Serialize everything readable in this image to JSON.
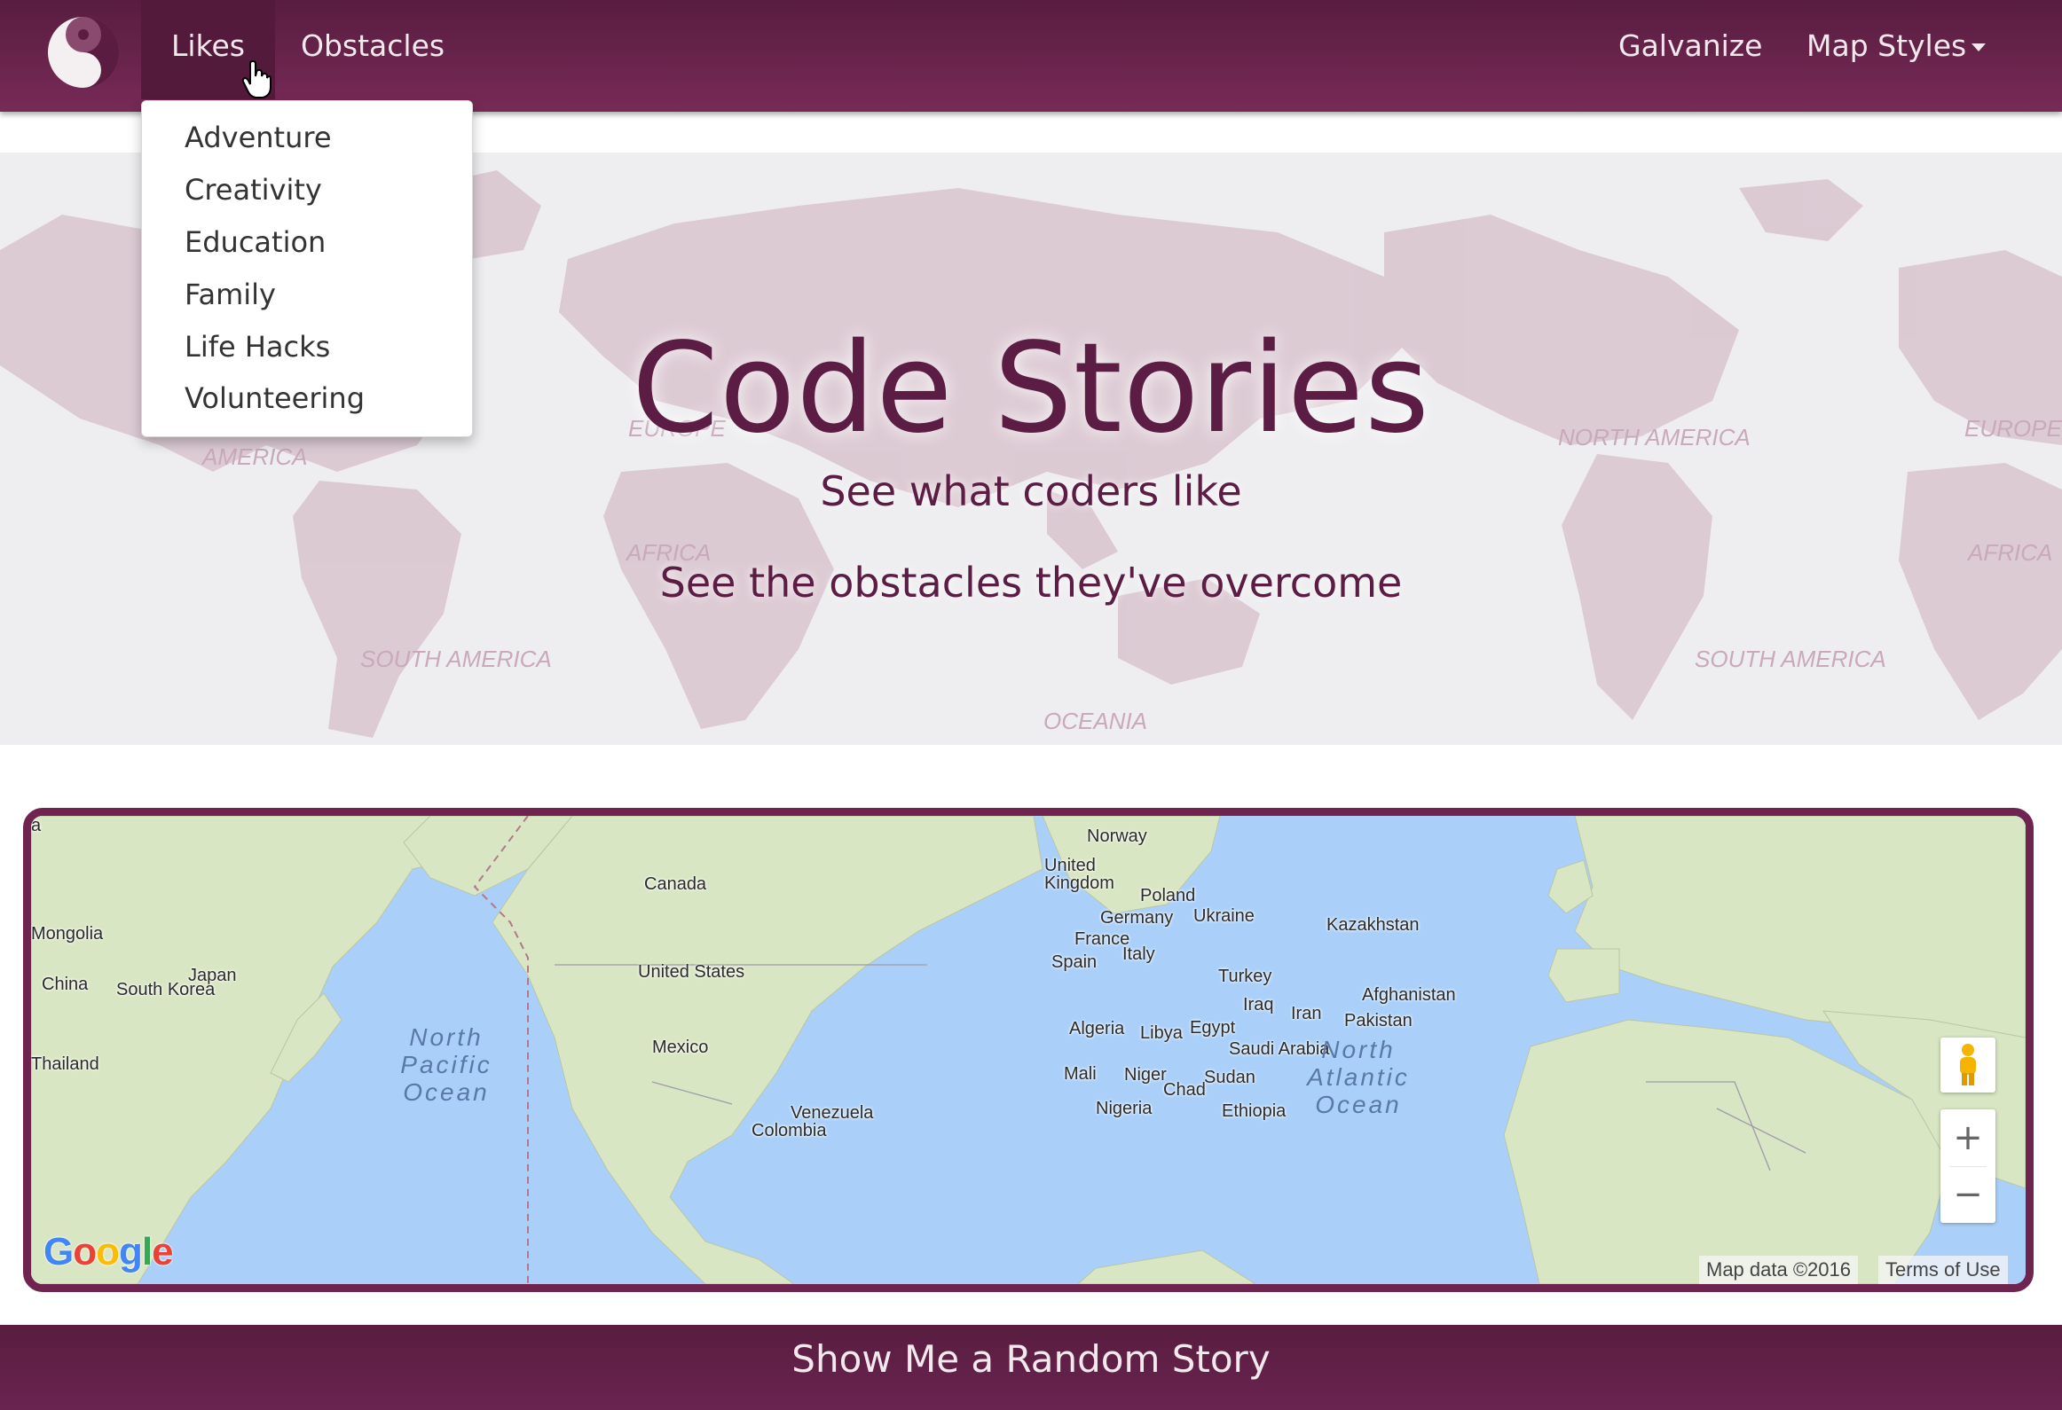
{
  "navbar": {
    "brand_icon": "yin-yang-icon",
    "left_items": [
      "Likes",
      "Obstacles"
    ],
    "active_item": "Likes",
    "right_items": [
      "Galvanize",
      "Map Styles"
    ],
    "accent_color": "#6f2450"
  },
  "likes_dropdown": {
    "items": [
      "Adventure",
      "Creativity",
      "Education",
      "Family",
      "Life Hacks",
      "Volunteering"
    ]
  },
  "hero": {
    "title": "Code Stories",
    "subtitle_1": "See what coders like",
    "subtitle_2": "See the obstacles they've overcome",
    "background_labels": [
      "EUROPE",
      "AMERICA",
      "NORTH AMERICA",
      "EUROPE",
      "AFRICA",
      "AFRICA",
      "SOUTH AMERICA",
      "OCEANIA",
      "SOUTH AMERICA"
    ]
  },
  "map": {
    "countries": [
      "Canada",
      "Norway",
      "United Kingdom",
      "Poland",
      "Germany",
      "Ukraine",
      "Kazakhstan",
      "France",
      "Italy",
      "Spain",
      "Turkey",
      "Mongolia",
      "China",
      "Japan",
      "South Korea",
      "United States",
      "Iraq",
      "Iran",
      "Algeria",
      "Libya",
      "Egypt",
      "Saudi Arabia",
      "Mexico",
      "Mali",
      "Niger",
      "Chad",
      "Sudan",
      "Nigeria",
      "Ethiopia",
      "Venezuela",
      "Colombia",
      "Thailand",
      "a",
      "Afghanistan",
      "Pakistan"
    ],
    "oceans": [
      "North\nPacific\nOcean",
      "North\nAtlantic\nOcean"
    ],
    "logo_text": "Google",
    "attribution": "Map data ©2016",
    "terms": "Terms of Use",
    "zoom_in": "+",
    "zoom_out": "−",
    "pegman_icon": "street-view-pegman-icon"
  },
  "footer": {
    "button": "Show Me a Random Story"
  }
}
